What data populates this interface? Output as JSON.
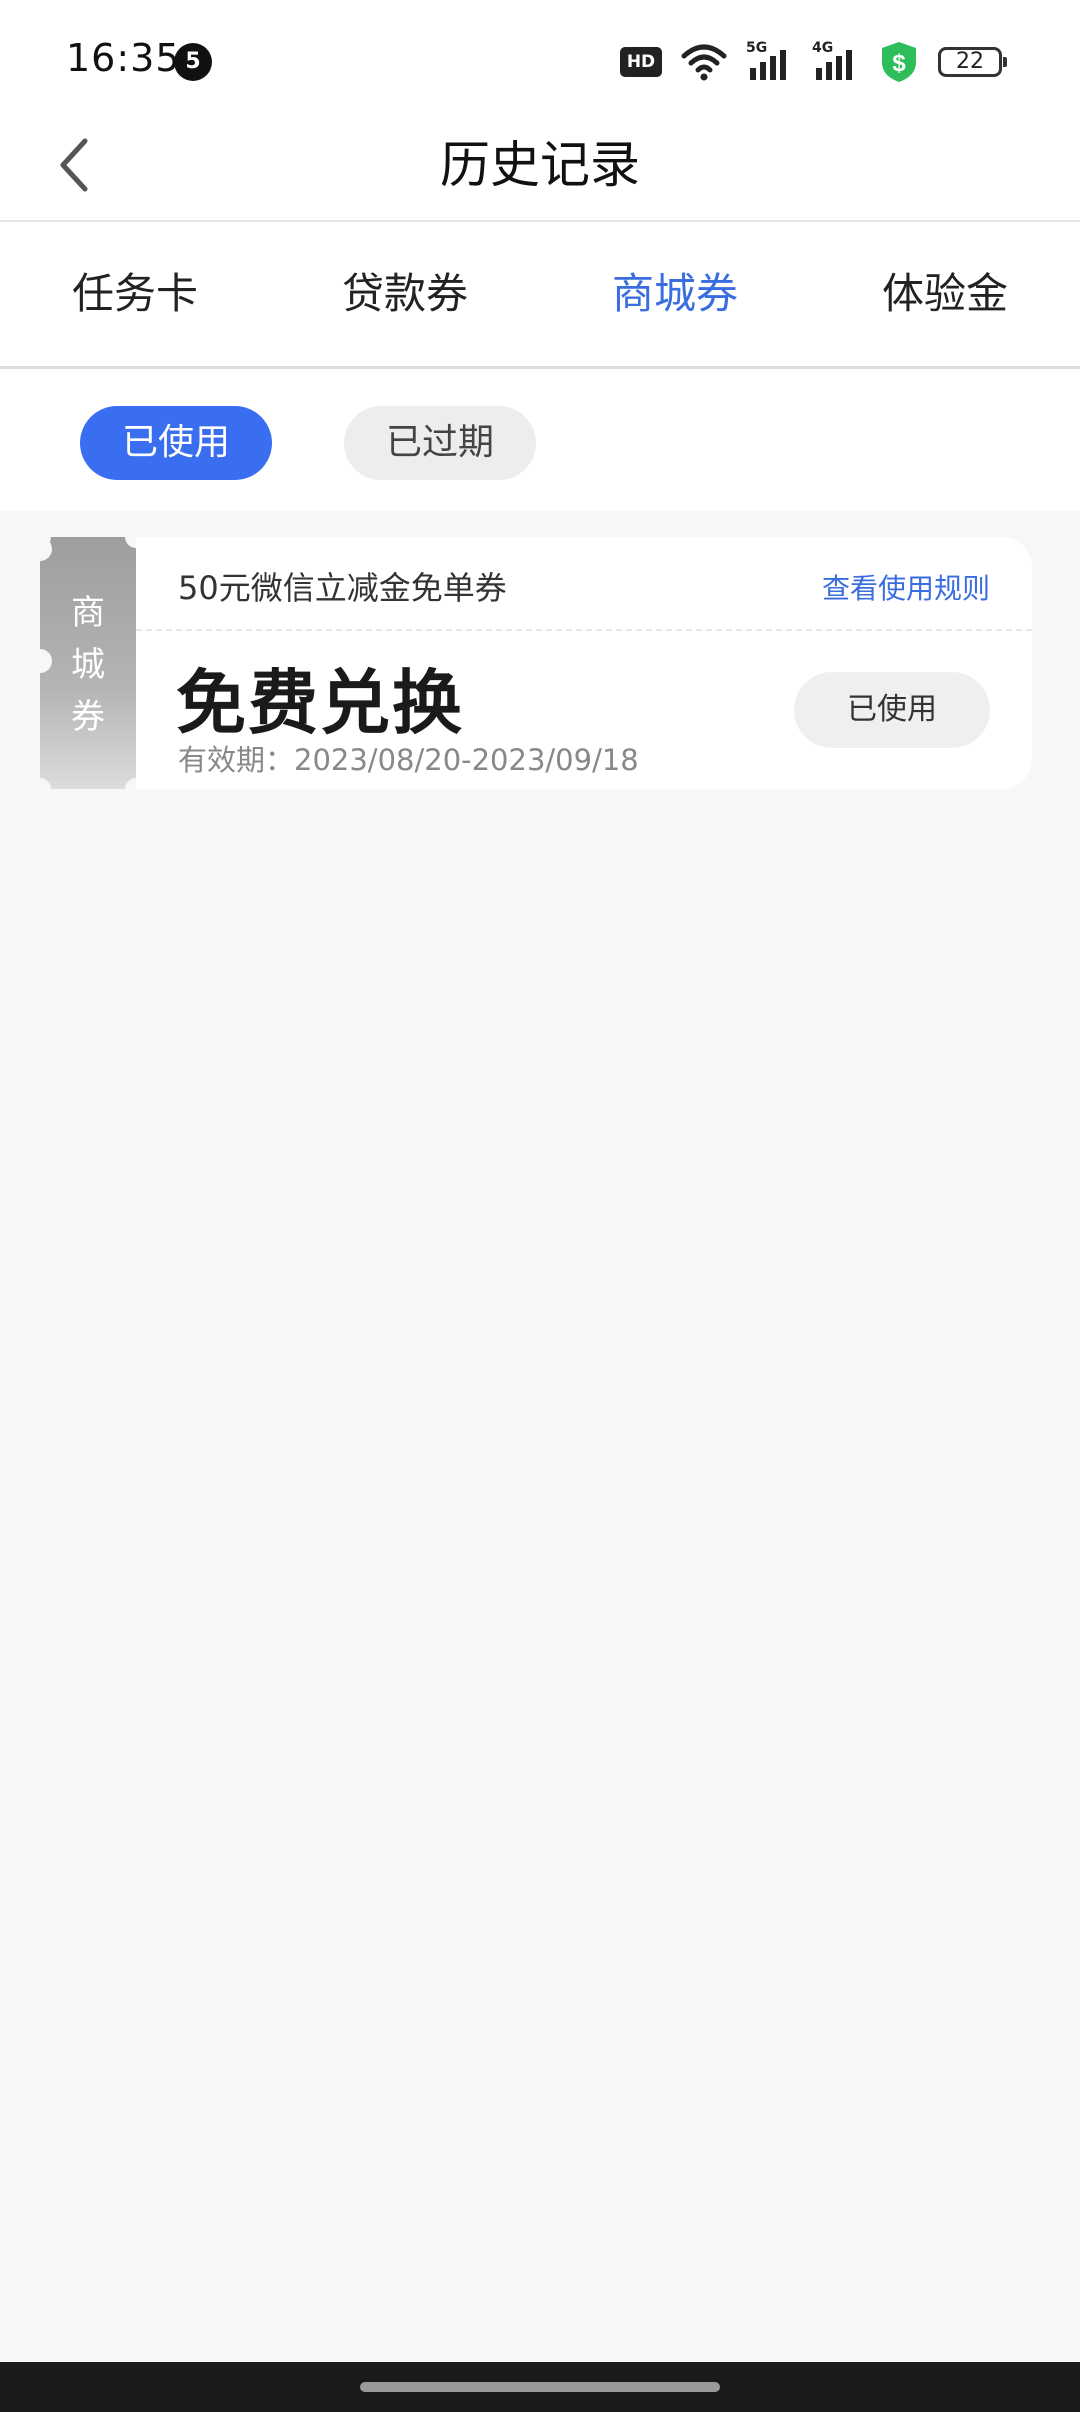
{
  "status_bar": {
    "time": "16:35",
    "notification_count": "5",
    "hd_label": "HD",
    "sim1_label": "5G",
    "sim2_label": "4G",
    "battery": "22"
  },
  "header": {
    "title": "历史记录"
  },
  "tabs": [
    {
      "label": "任务卡"
    },
    {
      "label": "贷款券"
    },
    {
      "label": "商城券"
    },
    {
      "label": "体验金"
    }
  ],
  "active_tab_index": 2,
  "filters": {
    "used": "已使用",
    "expired": "已过期"
  },
  "coupon": {
    "tag": "商城券",
    "name": "50元微信立减金免单券",
    "rules_link": "查看使用规则",
    "main_text": "免费兑换",
    "validity": "有效期：2023/08/20-2023/09/18",
    "status": "已使用"
  },
  "colors": {
    "accent": "#3a6de0",
    "chip_active": "#3a6ef0",
    "background": "#f7f7f7",
    "shield": "#2dbd5a"
  },
  "icons": {
    "back": "chevron-left-icon",
    "wifi": "wifi-icon",
    "security": "shield-dollar-icon"
  }
}
